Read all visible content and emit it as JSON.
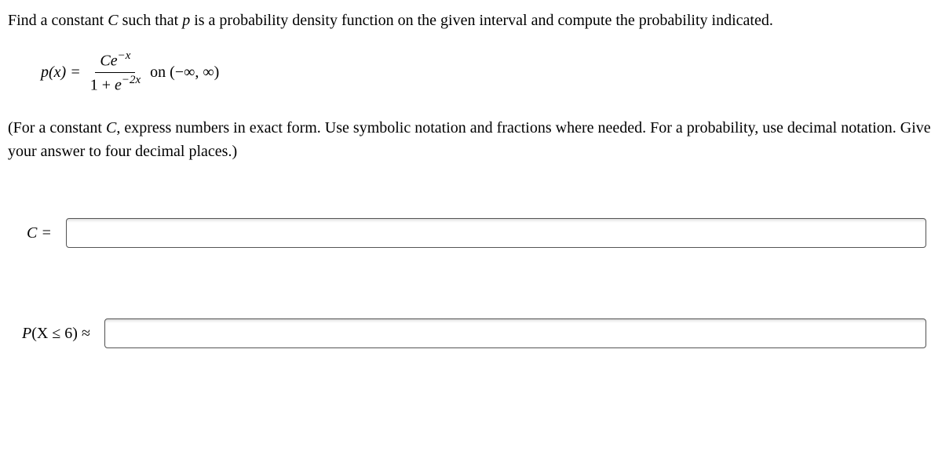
{
  "problem": {
    "statement_part1": "Find a constant ",
    "var_C": "C",
    "statement_part2": " such that ",
    "var_p": "p",
    "statement_part3": " is a probability density function on the given interval and compute the probability indicated."
  },
  "formula": {
    "lhs": "p(x) =",
    "numerator_C": "C",
    "numerator_e": "e",
    "numerator_exp": "−x",
    "denom_part1": "1 + ",
    "denom_e": "e",
    "denom_exp": "−2x",
    "on_text": " on (−∞, ∞)"
  },
  "hint": {
    "part1": "(For a constant ",
    "var_C": "C",
    "part2": ", express numbers in exact form. Use symbolic notation and fractions where needed. For a probability, use decimal notation. Give your answer to four decimal places.)"
  },
  "answers": {
    "label_C": "C =",
    "label_P_part1": "P",
    "label_P_part2": "(X ≤ 6) ≈"
  }
}
